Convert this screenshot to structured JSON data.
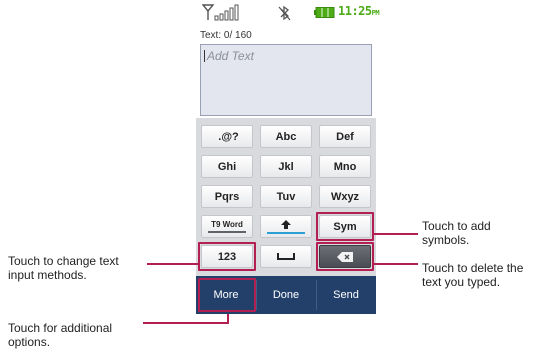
{
  "status_bar": {
    "time": "11:25",
    "ampm": "PM"
  },
  "message": {
    "counter": "Text: 0/ 160",
    "placeholder": "Add Text"
  },
  "keypad": {
    "rows": [
      [
        " .@?",
        "Abc",
        "Def"
      ],
      [
        "Ghi",
        "Jkl",
        "Mno"
      ],
      [
        "Pqrs",
        "Tuv",
        "Wxyz"
      ]
    ],
    "t9_label": "T9 Word",
    "sym_label": "Sym",
    "mode_label": "123"
  },
  "bottom_bar": {
    "more": "More",
    "done": "Done",
    "send": "Send"
  },
  "callouts": {
    "add_symbols_1": "Touch to add",
    "add_symbols_2": "symbols.",
    "change_input_1": "Touch to change text",
    "change_input_2": "input methods.",
    "delete_1": "Touch to delete the",
    "delete_2": "text you typed.",
    "options_1": "Touch for additional",
    "options_2": "options."
  },
  "colors": {
    "highlight": "#b41f52",
    "bottom_bar": "#23406b",
    "clock": "#4dab16"
  }
}
